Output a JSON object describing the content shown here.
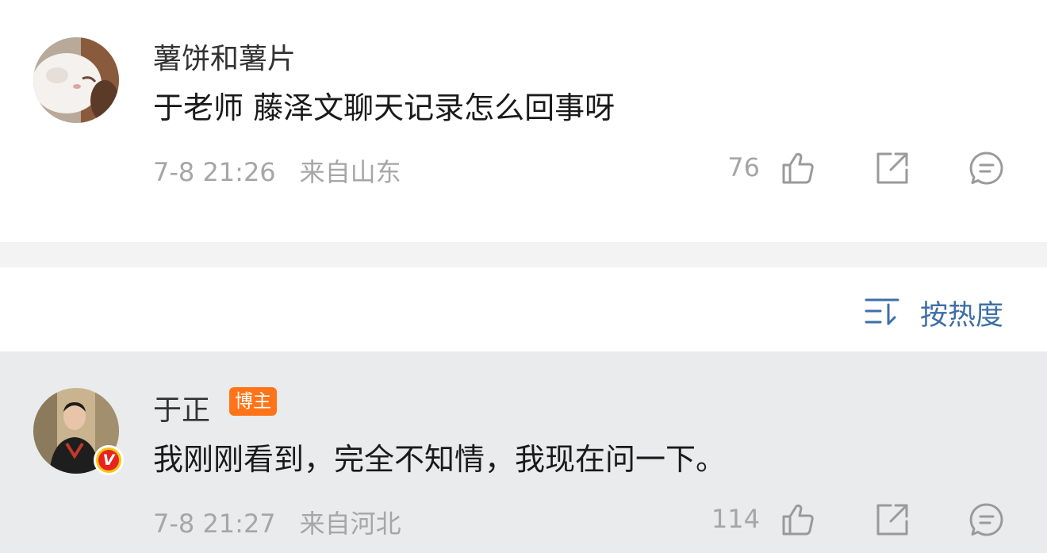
{
  "comments": [
    {
      "username": "薯饼和薯片",
      "text": "于老师 藤泽文聊天记录怎么回事呀",
      "time": "7-8 21:26",
      "location": "来自山东",
      "likes": "76",
      "badge": ""
    },
    {
      "username": "于正",
      "text": "我刚刚看到，完全不知情，我现在问一下。",
      "time": "7-8 21:27",
      "location": "来自河北",
      "likes": "114",
      "badge": "博主",
      "verified_mark": "V"
    }
  ],
  "sort": {
    "label": "按热度",
    "icon": "sort-icon"
  },
  "icons": {
    "like": "thumbs-up-icon",
    "share": "share-icon",
    "reply": "comment-icon"
  },
  "colors": {
    "accent": "#3f6ea6",
    "badge": "#ff7419",
    "highlight_bg": "#e9ebed",
    "meta_text": "#a6a6a6"
  }
}
